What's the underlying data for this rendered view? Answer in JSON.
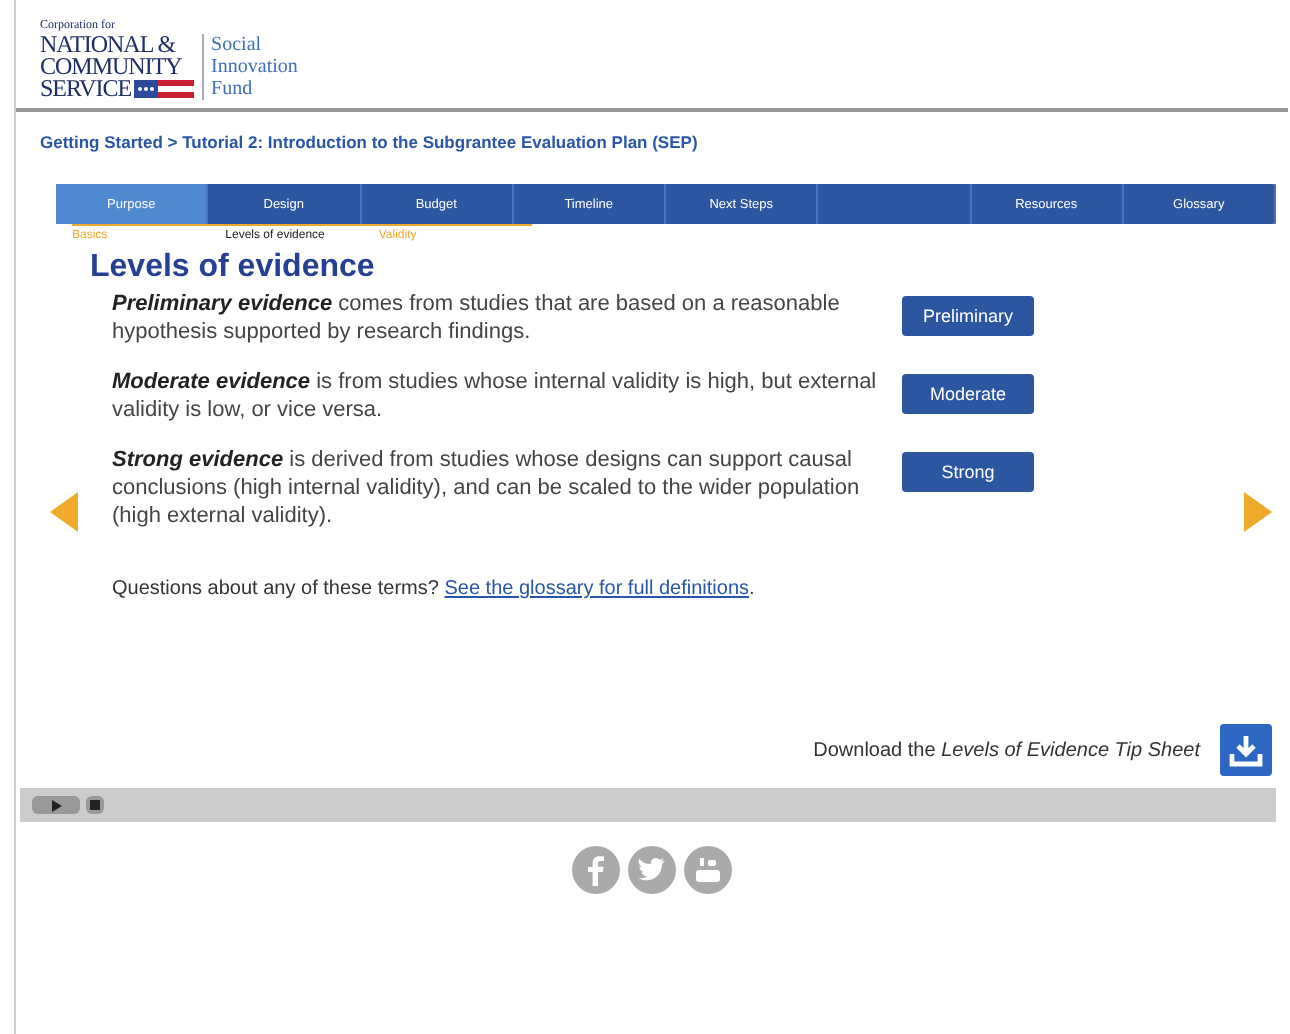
{
  "logo": {
    "small": "Corporation for",
    "lines": [
      "NATIONAL &",
      "COMMUNITY",
      "SERVICE"
    ],
    "program": [
      "Social",
      "Innovation",
      "Fund"
    ]
  },
  "breadcrumb": "Getting Started > Tutorial 2: Introduction to the Subgrantee Evaluation Plan (SEP)",
  "nav": [
    {
      "label": "Purpose",
      "selected": true
    },
    {
      "label": "Design",
      "selected": false
    },
    {
      "label": "Budget",
      "selected": false
    },
    {
      "label": "Timeline",
      "selected": false
    },
    {
      "label": "Next Steps",
      "selected": false
    },
    {
      "selected": false
    },
    {
      "label": "Resources",
      "selected": false
    },
    {
      "label": "Glossary",
      "selected": false
    }
  ],
  "subnav": [
    {
      "label": "Basics",
      "selected": false
    },
    {
      "label": "Levels of evidence",
      "selected": true
    },
    {
      "label": "Validity",
      "selected": false
    }
  ],
  "title": "Levels of evidence",
  "items": [
    {
      "text": "**Preliminary evidence** comes from studies that are based on a reasonable hypothesis supported by research findings.",
      "button": "Preliminary"
    },
    {
      "text": "**Moderate evidence** is from studies whose internal validity is high, but external validity is low, or vice versa.",
      "button": "Moderate"
    },
    {
      "text": "**Strong evidence** is derived from studies whose designs can support causal conclusions (high internal validity), and can be scaled to the wider population (high external validity).",
      "button": "Strong"
    }
  ],
  "question": "Questions about any of these terms?",
  "glossary_link": "See the glossary for full definitions",
  "question_end": ".",
  "download": "Download the *Levels of Evidence Tip Sheet*"
}
